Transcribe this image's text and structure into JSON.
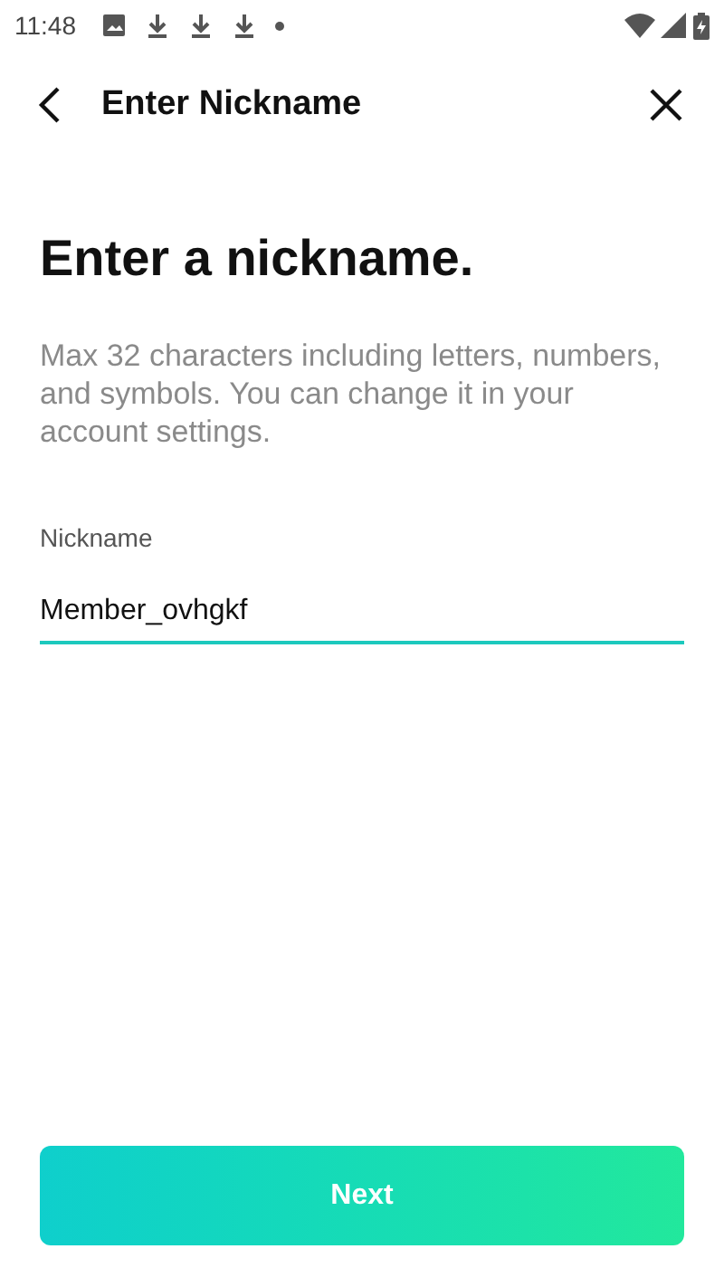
{
  "status_bar": {
    "time": "11:48"
  },
  "header": {
    "title": "Enter Nickname"
  },
  "heading": "Enter a nickname.",
  "description": "Max 32 characters including letters, numbers, and symbols. You can change it in your account settings.",
  "nickname_field": {
    "label": "Nickname",
    "value": "Member_ovhgkf"
  },
  "next_button": {
    "label": "Next"
  }
}
